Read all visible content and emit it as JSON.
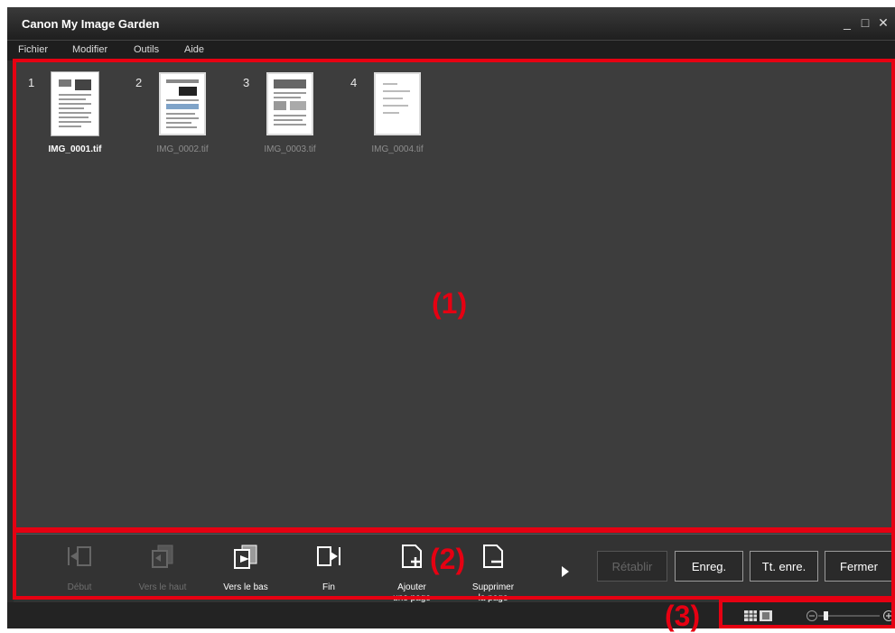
{
  "window": {
    "title": "Canon My Image Garden",
    "controls": {
      "minimize": "_",
      "maximize": "□",
      "close": "✕"
    }
  },
  "menu": {
    "items": [
      "Fichier",
      "Modifier",
      "Outils",
      "Aide"
    ]
  },
  "thumbnails": [
    {
      "number": "1",
      "filename": "IMG_0001.tif",
      "selected": true
    },
    {
      "number": "2",
      "filename": "IMG_0002.tif",
      "selected": false
    },
    {
      "number": "3",
      "filename": "IMG_0003.tif",
      "selected": false
    },
    {
      "number": "4",
      "filename": "IMG_0004.tif",
      "selected": false
    }
  ],
  "callouts": {
    "area1": "(1)",
    "area2": "(2)",
    "area3": "(3)"
  },
  "toolbar": {
    "tools": [
      {
        "label": "Début",
        "icon": "move-to-start-icon",
        "enabled": false
      },
      {
        "label": "Vers le haut",
        "icon": "move-up-icon",
        "enabled": false
      },
      {
        "label": "Vers le bas",
        "icon": "move-down-icon",
        "enabled": true
      },
      {
        "label": "Fin",
        "icon": "move-to-end-icon",
        "enabled": true
      },
      {
        "label": "Ajouter\nune page",
        "icon": "add-page-icon",
        "enabled": true
      },
      {
        "label": "Supprimer\nla page",
        "icon": "delete-page-icon",
        "enabled": true
      }
    ],
    "more_icon": "play-arrow-icon",
    "buttons": {
      "undo": {
        "label": "Rétablir",
        "enabled": false
      },
      "save": {
        "label": "Enreg.",
        "enabled": true
      },
      "save_all": {
        "label": "Tt. enre.",
        "enabled": true
      },
      "close": {
        "label": "Fermer",
        "enabled": true
      }
    }
  },
  "statusbar": {
    "view_icons": [
      "thumbnail-view-icon",
      "detail-view-icon"
    ],
    "zoom_out_icon": "zoom-out-icon",
    "zoom_in_icon": "zoom-in-icon"
  },
  "colors": {
    "accent_red": "#e60012",
    "background": "#3d3d3d"
  }
}
